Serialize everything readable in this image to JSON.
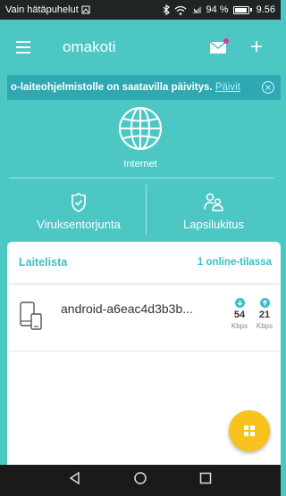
{
  "status_bar": {
    "carrier": "Vain hätäpuhelut",
    "battery": "94 %",
    "time": "9.56"
  },
  "toolbar": {
    "title": "omakoti"
  },
  "banner": {
    "text": "o-laiteohjelmistolle on saatavilla päivitys.",
    "link": "Päivit"
  },
  "internet": {
    "label": "Internet"
  },
  "features": {
    "antivirus": "Viruksentorjunta",
    "parental": "Lapsilukitus"
  },
  "devices": {
    "title": "Laitelista",
    "online_count": "1 online-tilassa",
    "items": [
      {
        "name": "android-a6eac4d3b3b...",
        "download": "54",
        "upload": "21",
        "unit": "Kbps"
      }
    ]
  },
  "colors": {
    "background": "#4cc7c4",
    "accent": "#3cbec4",
    "fab": "#f7c21b",
    "notification_dot": "#e0348c"
  }
}
